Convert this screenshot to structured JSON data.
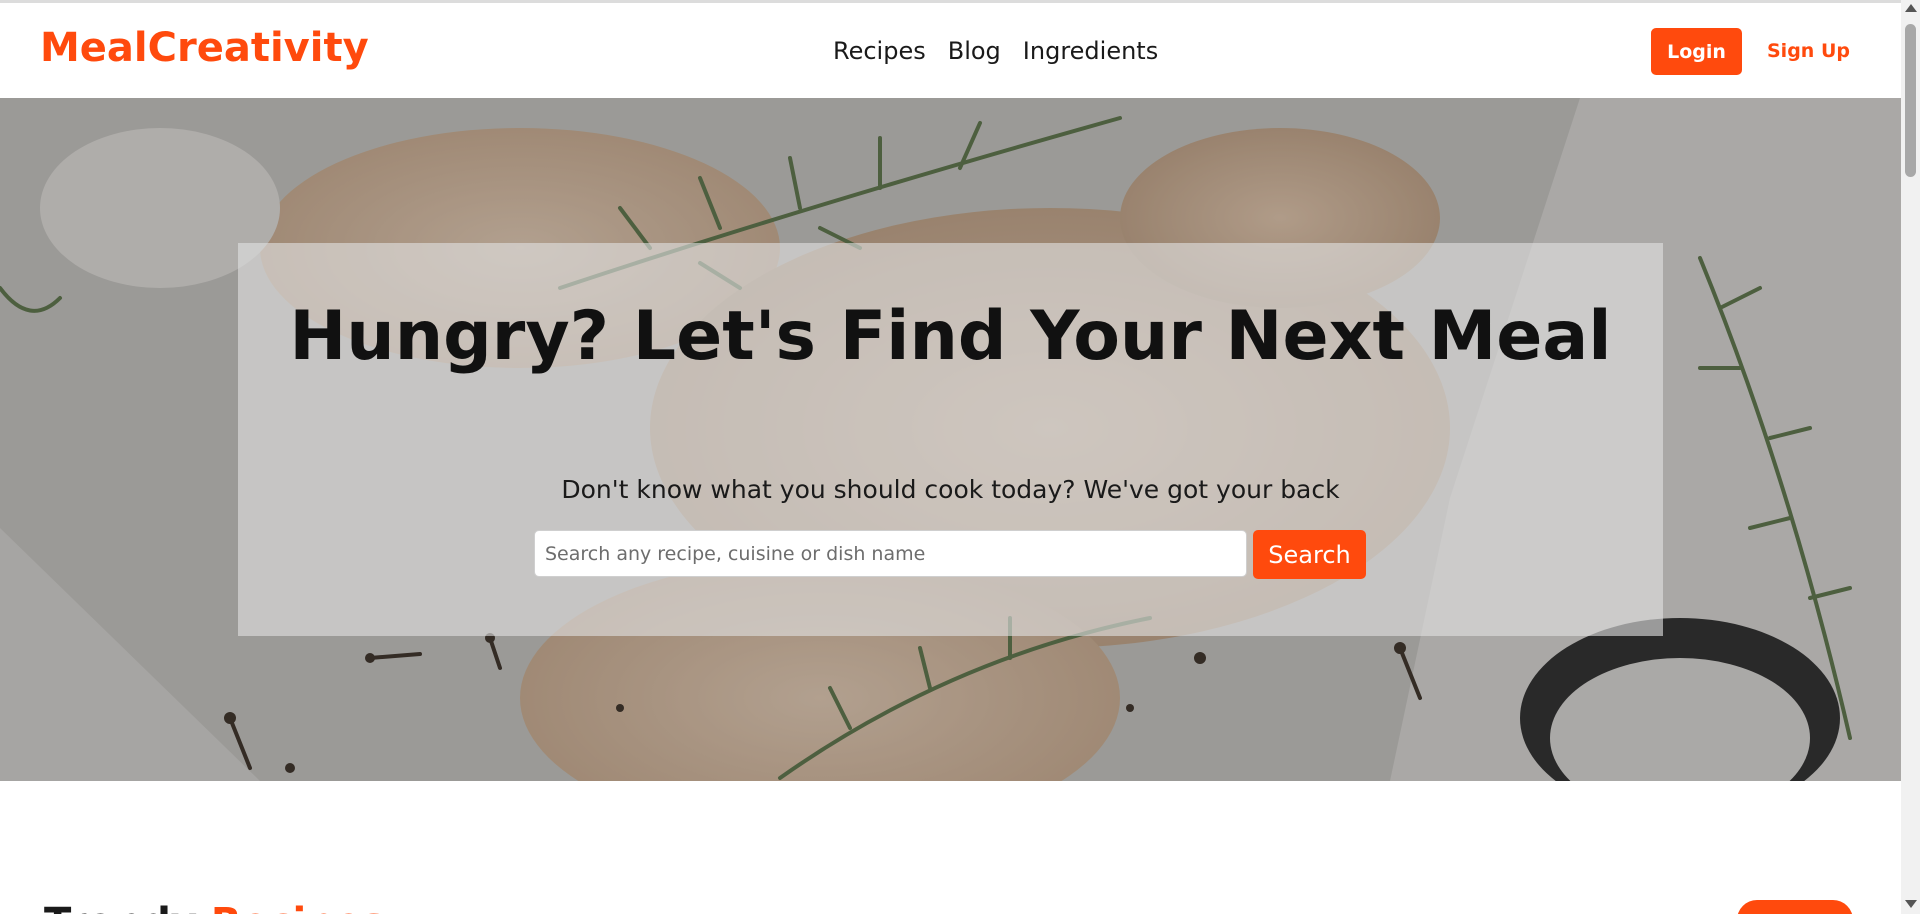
{
  "brand": {
    "name": "MealCreativity",
    "color": "#ff4a0d"
  },
  "nav": {
    "links": [
      "Recipes",
      "Blog",
      "Ingredients"
    ],
    "login_label": "Login",
    "signup_label": "Sign Up"
  },
  "hero": {
    "title": "Hungry? Let's Find Your Next Meal",
    "subtitle": "Don't know what you should cook today? We've got your back",
    "search_placeholder": "Search any recipe, cuisine or dish name",
    "search_value": "",
    "search_button": "Search"
  },
  "section": {
    "heading_start": "Trendy",
    "heading_accent": "Recipes"
  },
  "colors": {
    "accent": "#ff4a0d"
  }
}
